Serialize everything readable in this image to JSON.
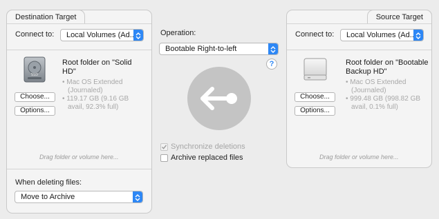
{
  "destination": {
    "tab_label": "Destination Target",
    "connect_label": "Connect to:",
    "connect_value": "Local Volumes (Ad...",
    "title_line1": "Root folder on \"Solid",
    "title_line2": "HD\"",
    "info1": "• Mac OS Extended",
    "info2": "(Journaled)",
    "info3": "• 119.17 GB (9.16 GB",
    "info4": "avail, 92.3% full)",
    "choose_label": "Choose...",
    "options_label": "Options...",
    "drag_hint": "Drag folder or volume here...",
    "when_deleting_label": "When deleting files:",
    "when_deleting_value": "Move to Archive"
  },
  "source": {
    "tab_label": "Source Target",
    "connect_label": "Connect to:",
    "connect_value": "Local Volumes (Ad...",
    "title_line1": "Root folder on \"Bootable",
    "title_line2": "Backup HD\"",
    "info1": "• Mac OS Extended",
    "info2": "(Journaled)",
    "info3": "• 999.48 GB (998.82 GB",
    "info4": "avail, 0.1% full)",
    "choose_label": "Choose...",
    "options_label": "Options...",
    "drag_hint": "Drag folder or volume here..."
  },
  "operation": {
    "label": "Operation:",
    "value": "Bootable Right-to-left",
    "help": "?",
    "sync_label": "Synchronize deletions",
    "sync_checked": true,
    "sync_disabled": true,
    "archive_label": "Archive replaced files",
    "archive_checked": false
  }
}
